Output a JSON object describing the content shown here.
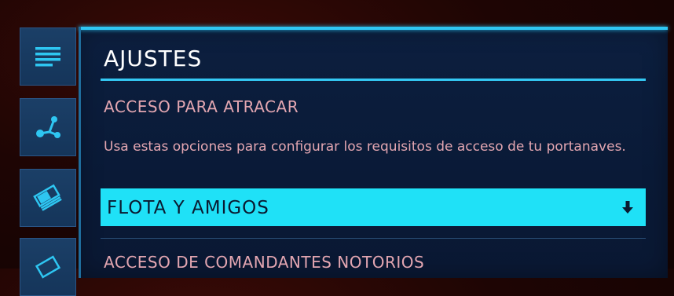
{
  "sidebar": {
    "tabs": [
      {
        "icon": "list-icon"
      },
      {
        "icon": "network-nodes-icon"
      },
      {
        "icon": "credits-stack-icon"
      },
      {
        "icon": "cargo-icon"
      }
    ],
    "colors": {
      "tab_bg": "#1b3f67",
      "icon": "#2ec6f2"
    }
  },
  "panel": {
    "title": "AJUSTES",
    "section_heading": "ACCESO PARA ATRACAR",
    "description": "Usa estas opciones para configurar los requisitos de acceso de tu portanaves.",
    "dropdown": {
      "value": "FLOTA Y AMIGOS",
      "arrow_icon": "down-arrow-icon"
    },
    "next_heading": "ACCESO DE COMANDANTES NOTORIOS"
  },
  "colors": {
    "accent": "#2fc6f2",
    "dropdown_bg": "#1fe1f7",
    "text_pink": "#e3a6b1",
    "panel_bg": "#0c1f3f"
  }
}
